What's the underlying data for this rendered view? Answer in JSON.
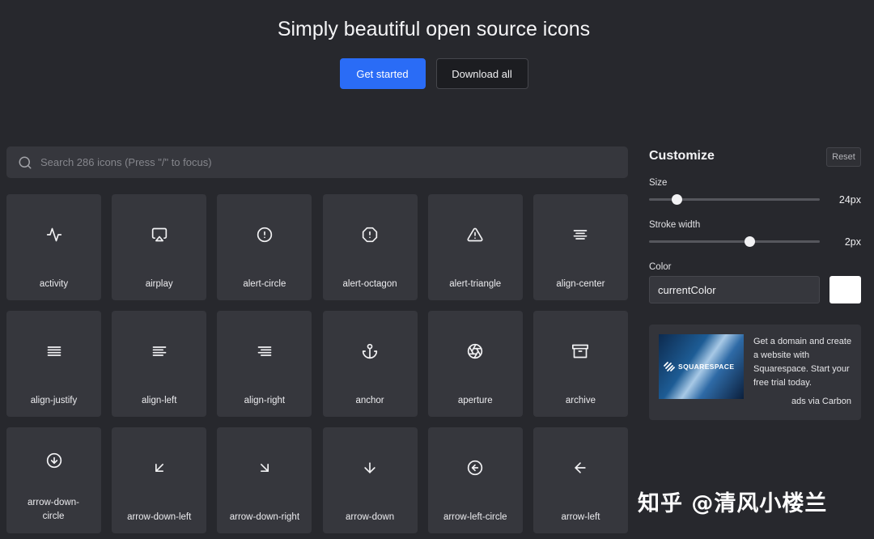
{
  "hero": {
    "title": "Simply beautiful open source icons",
    "get_started_label": "Get started",
    "download_label": "Download all"
  },
  "search": {
    "placeholder": "Search 286 icons (Press \"/\" to focus)",
    "value": ""
  },
  "icons": [
    {
      "label": "activity",
      "icon": "activity-icon"
    },
    {
      "label": "airplay",
      "icon": "airplay-icon"
    },
    {
      "label": "alert-circle",
      "icon": "alert-circle-icon"
    },
    {
      "label": "alert-octagon",
      "icon": "alert-octagon-icon"
    },
    {
      "label": "alert-triangle",
      "icon": "alert-triangle-icon"
    },
    {
      "label": "align-center",
      "icon": "align-center-icon"
    },
    {
      "label": "align-justify",
      "icon": "align-justify-icon"
    },
    {
      "label": "align-left",
      "icon": "align-left-icon"
    },
    {
      "label": "align-right",
      "icon": "align-right-icon"
    },
    {
      "label": "anchor",
      "icon": "anchor-icon"
    },
    {
      "label": "aperture",
      "icon": "aperture-icon"
    },
    {
      "label": "archive",
      "icon": "archive-icon"
    },
    {
      "label": "arrow-down-circle",
      "icon": "arrow-down-circle-icon"
    },
    {
      "label": "arrow-down-left",
      "icon": "arrow-down-left-icon"
    },
    {
      "label": "arrow-down-right",
      "icon": "arrow-down-right-icon"
    },
    {
      "label": "arrow-down",
      "icon": "arrow-down-icon"
    },
    {
      "label": "arrow-left-circle",
      "icon": "arrow-left-circle-icon"
    },
    {
      "label": "arrow-left",
      "icon": "arrow-left-icon"
    }
  ],
  "customize": {
    "title": "Customize",
    "reset_label": "Reset",
    "size": {
      "label": "Size",
      "value": "24px",
      "fraction": 0.16
    },
    "stroke": {
      "label": "Stroke width",
      "value": "2px",
      "fraction": 0.59
    },
    "color": {
      "label": "Color",
      "value": "currentColor",
      "swatch": "#ffffff"
    }
  },
  "ad": {
    "brand": "SQUARESPACE",
    "text": "Get a domain and create a website with Squarespace. Start your free trial today.",
    "via": "ads via Carbon"
  },
  "watermark": "知乎 @清风小楼兰",
  "colors": {
    "background": "#27282d",
    "tile": "#36373d",
    "accent": "#2a6cf6"
  }
}
